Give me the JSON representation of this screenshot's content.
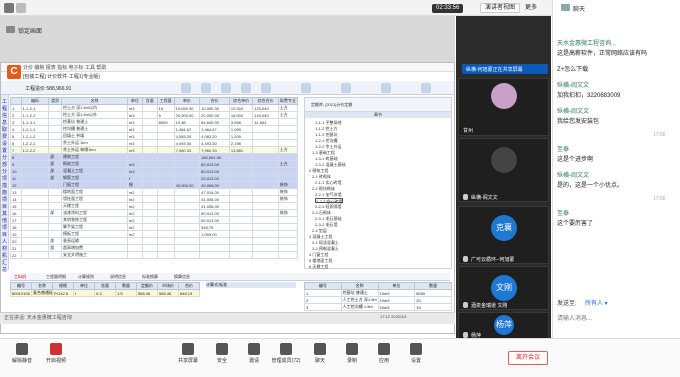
{
  "topbar": {
    "time": "02:33:56",
    "speaker_view": "演讲者视图",
    "more": "更多"
  },
  "ppt": {
    "label": "锁定画面"
  },
  "app": {
    "title_tabs": "计价  编制  报表  指标  电子标  工具  帮助",
    "file": "[包装工程] 计价软件-工程1(专业版)",
    "price_label": "工程造价",
    "price_value": "588,966.91"
  },
  "sidebar": {
    "text": "工程信息  取费设置  分部分项  措施项目  其他项目  人材机汇总"
  },
  "ltable": {
    "headers": [
      "",
      "编码",
      "类别",
      "名称",
      "单位",
      "含量",
      "工程量",
      "单价",
      "合价",
      "综合单价",
      "综合合价",
      "取费专业"
    ],
    "rows": [
      [
        "1",
        "1-1-2-1",
        "",
        "挖土方 深1.5m以内",
        "m3",
        "",
        "15",
        "10,090.30",
        "10,090.30",
        "12,004",
        "120,040",
        "土方"
      ],
      [
        "2",
        "1-1-2-2",
        "",
        "挖土方 深1.5m以外",
        "m3",
        "",
        "5",
        "20,000.00",
        "20,000.00",
        "18,000",
        "144,040",
        "土方"
      ],
      [
        "3",
        "1-1-3-1",
        "",
        "挖基坑 普通土",
        "m3",
        "",
        "8000",
        "10.58",
        "84,640.00",
        "3,958",
        "31,664",
        ""
      ],
      [
        "4",
        "1-2-1-1",
        "",
        "挖沟槽 普通土",
        "m3",
        "",
        "",
        "1,464.67",
        "1,464.67",
        "1,099",
        "",
        ""
      ],
      [
        "5",
        "1-2-1-2",
        "",
        "回填土 夯填",
        "m3",
        "",
        "",
        "4,083.20",
        "4,083.20",
        "1,205",
        "",
        ""
      ],
      [
        "6",
        "1-2-2-1",
        "",
        "余土外运 1km",
        "m3",
        "",
        "",
        "4,493.30",
        "4,493.30",
        "2,198",
        "",
        ""
      ],
      [
        "7",
        "1-2-2-2",
        "",
        "余土外运 每增1km",
        "m3",
        "",
        "",
        "7,960.33",
        "7,960.33",
        "13,881",
        "",
        "土方"
      ],
      [
        "8",
        "",
        "部",
        "建筑工程",
        "",
        "",
        "",
        "",
        "180,961.00",
        "",
        "",
        ""
      ],
      [
        "9",
        "",
        "部",
        "砌筑工程",
        "m3",
        "",
        "",
        "",
        "80,013.00",
        "",
        "",
        "土方"
      ],
      [
        "10",
        "",
        "部",
        "混凝土工程",
        "m3",
        "",
        "",
        "",
        "80,013.00",
        "",
        "",
        ""
      ],
      [
        "11",
        "",
        "部",
        "钢筋工程",
        "t",
        "",
        "",
        "",
        "20,013.00",
        "",
        "",
        ""
      ],
      [
        "12",
        "",
        "",
        "门窗工程",
        "樘",
        "",
        "",
        "40,006.00",
        "40,006.00",
        "",
        "",
        "装饰"
      ],
      [
        "13",
        "",
        "",
        "楼地面工程",
        "m2",
        "",
        "",
        "",
        "47,016.00",
        "",
        "",
        "装饰"
      ],
      [
        "14",
        "",
        "",
        "墙柱面工程",
        "m2",
        "",
        "",
        "",
        "41,006.00",
        "",
        "",
        "装饰"
      ],
      [
        "15",
        "",
        "",
        "天棚工程",
        "m2",
        "",
        "",
        "",
        "41,006.00",
        "",
        "",
        ""
      ],
      [
        "16",
        "",
        "部",
        "油漆涂料工程",
        "m2",
        "",
        "",
        "",
        "80,013.00",
        "",
        "",
        "装饰"
      ],
      [
        "17",
        "",
        "",
        "其他装饰工程",
        "m2",
        "",
        "",
        "",
        "80,013.00",
        "",
        "",
        ""
      ],
      [
        "18",
        "",
        "",
        "脚手架工程",
        "m2",
        "",
        "",
        "",
        "545.75",
        "",
        "",
        ""
      ],
      [
        "19",
        "",
        "",
        "模板工程",
        "m2",
        "",
        "",
        "",
        "1,093.00",
        "",
        "",
        ""
      ],
      [
        "20",
        "",
        "部",
        "垂直运输",
        "",
        "",
        "",
        "",
        "",
        "",
        "",
        ""
      ],
      [
        "21",
        "",
        "部",
        "超高增加费",
        "",
        "",
        "",
        "",
        "",
        "",
        "",
        ""
      ],
      [
        "22",
        "",
        "",
        "安全文明施工",
        "",
        "",
        "",
        "",
        "",
        "",
        "",
        ""
      ]
    ]
  },
  "rtree": {
    "title": "定额库: [2021]计价定额",
    "col": "章节",
    "items": [
      "1-1-1 平整场地",
      "1-1-2 挖土方",
      "1-1-3 挖基坑",
      "1-2-1 挖沟槽",
      "1-2-2 余土外运",
      "1-3 基础工程",
      "1-3-1 砖基础",
      "1-3-2 混凝土基础",
      "2 砌筑工程",
      "2-1 砖砌体",
      "2-1-1 实心砖墙",
      "2-2 砌块砌体",
      "2-2-1 加气块墙",
      "2-2-2 空心砖墙",
      "2-2-3 轻质隔墙",
      "2-3 石砌体",
      "2-3-1 毛石基础",
      "2-3-2 毛石墙",
      "2-4 垫层",
      "3 混凝土工程",
      "3-1 现浇混凝土",
      "3-2 预制混凝土",
      "4 门窗工程",
      "5 楼地面工程",
      "6 天棚工程"
    ]
  },
  "bottom_tabs": [
    "工料机",
    "工程量明细",
    "计算规则",
    "说明信息",
    "标准换算",
    "换算信息"
  ],
  "btable": {
    "headers": [
      "编号",
      "名称",
      "规格",
      "单位",
      "含量",
      "数量",
      "定额价",
      "市场价",
      "合价"
    ],
    "row": [
      "80010105",
      "复合普通硅酸盐水泥",
      "P.O42.5",
      "t",
      "0.3",
      "1.5",
      "565.46",
      "565.46",
      "848.19"
    ]
  },
  "mid_head": "计算式/标准",
  "rtable": {
    "headers": [
      "编号",
      "名称",
      "单位",
      "数量"
    ],
    "rows": [
      [
        "1",
        "挖基坑 普通土",
        "10m3",
        "8000"
      ],
      [
        "2",
        "人工挖土方 深1.5m",
        "10m3",
        "20"
      ],
      [
        "3",
        "人工挖沟槽 1.5m",
        "10m3",
        "15"
      ]
    ]
  },
  "screen_footer": {
    "speaker": "正在讲话: 天水金惠微工程咨询",
    "datetime": "17:12 2020/3/1"
  },
  "participants": [
    {
      "name": "甘州",
      "avatar_text": "",
      "color": "#c9a0c8"
    },
    {
      "name": "纵横-阎文文",
      "avatar_text": "",
      "color": "#444"
    },
    {
      "name": "广可云循环--何旭蒙",
      "avatar_text": "克襄",
      "color": "#1f78d1"
    },
    {
      "name": "酒泉金瑞道 文刚",
      "avatar_text": "文刚",
      "color": "#1f78d1"
    },
    {
      "name": "杨萍",
      "avatar_text": "杨萍",
      "color": "#1f78d1"
    }
  ],
  "screen_share_label": "纵横-何旭蒙正在共享屏幕",
  "chat": {
    "title": "聊天",
    "messages": [
      {
        "name": "天水金惠微工程咨询...",
        "text": "这是高薪软件，正常网络应该有吗"
      },
      {
        "name": "",
        "text": "Z+怎么下载"
      },
      {
        "name": "纵横-阎文文",
        "text": "加我扣扣，3220683009"
      },
      {
        "name": "纵横-阎文文",
        "text": "我给您发安装包",
        "time": "17:06"
      },
      {
        "name": "至泰",
        "text": "这是个进步啊"
      },
      {
        "name": "纵横-阎文文",
        "text": "是的，这是一个小优点。",
        "time": "17:06"
      },
      {
        "name": "至泰",
        "text": "这个要厉害了"
      }
    ],
    "send_to_label": "发送至:",
    "send_to_value": "所有人 ▾",
    "input_placeholder": "请输入消息..."
  },
  "controls": [
    {
      "name": "mute-button",
      "label": "解除静音",
      "icon": "microphone-icon"
    },
    {
      "name": "video-button",
      "label": "开启视频",
      "icon": "camera-icon"
    },
    {
      "name": "share-screen-button",
      "label": "共享屏幕",
      "icon": "share-screen-icon"
    },
    {
      "name": "security-button",
      "label": "安全",
      "icon": "shield-icon"
    },
    {
      "name": "invite-button",
      "label": "邀请",
      "icon": "invite-icon"
    },
    {
      "name": "participants-button",
      "label": "管理成员(72)",
      "icon": "people-icon"
    },
    {
      "name": "chat-button",
      "label": "聊天",
      "icon": "chat-icon"
    },
    {
      "name": "record-button",
      "label": "录制",
      "icon": "record-icon"
    },
    {
      "name": "apps-button",
      "label": "应用",
      "icon": "apps-icon"
    },
    {
      "name": "settings-button",
      "label": "设置",
      "icon": "gear-icon"
    }
  ],
  "leave_button": "离开会议"
}
